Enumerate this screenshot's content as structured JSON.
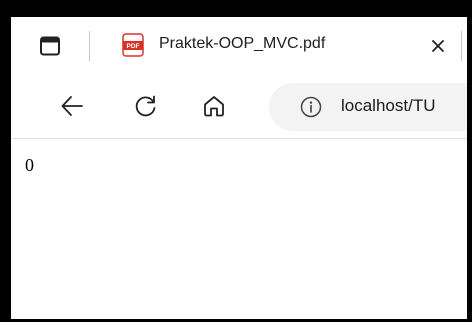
{
  "browser": {
    "tab": {
      "title": "Praktek-OOP_MVC.pdf",
      "favicon_icon": "pdf-icon",
      "favicon_label": "PDF",
      "favicon_color": "#d9322b"
    },
    "toolbar": {
      "back_icon": "back-arrow-icon",
      "refresh_icon": "refresh-icon",
      "home_icon": "home-icon"
    },
    "address_bar": {
      "info_icon": "info-icon",
      "url": "localhost/TU"
    }
  },
  "page": {
    "output_text": "0"
  }
}
